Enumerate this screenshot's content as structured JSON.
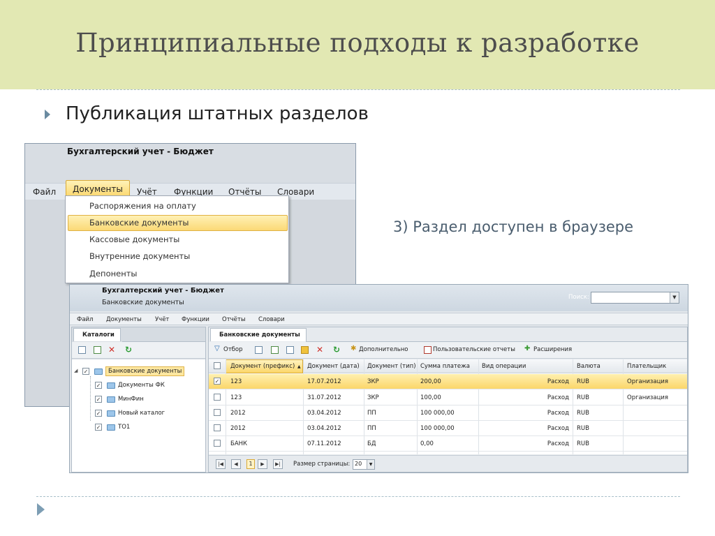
{
  "slide": {
    "title": "Принципиальные подходы к разработке",
    "bullet": "Публикация штатных разделов",
    "note": "3) Раздел доступен в браузере"
  },
  "desktop": {
    "title": "Бухгалтерский учет - Бюджет",
    "menu": [
      "Файл",
      "Документы",
      "Учёт",
      "Функции",
      "Отчёты",
      "Словари"
    ],
    "dropdown": [
      "Распоряжения на оплату",
      "Банковские документы",
      "Кассовые документы",
      "Внутренние документы",
      "Депоненты"
    ]
  },
  "web": {
    "title": "Бухгалтерский учет - Бюджет",
    "subtitle": "Банковские документы",
    "search_label": "Поиск:",
    "search_value": "",
    "menu": [
      "Файл",
      "Документы",
      "Учёт",
      "Функции",
      "Отчёты",
      "Словари"
    ],
    "left_tab": "Каталоги",
    "tree": [
      {
        "label": "Банковские документы",
        "checked": true,
        "selected": true
      },
      {
        "label": "Документы ФК",
        "checked": true
      },
      {
        "label": "МинФин",
        "checked": true
      },
      {
        "label": "Новый каталог",
        "checked": true
      },
      {
        "label": "ТО1",
        "checked": true
      }
    ],
    "right_tab": "Банковские документы",
    "toolbar": {
      "filter": "Отбор",
      "extra": "Дополнительно",
      "user_reports": "Пользовательские отчеты",
      "extensions": "Расширения"
    },
    "grid": {
      "columns": [
        "Документ (префикс)",
        "Документ (дата)",
        "Документ (тип)",
        "Сумма платежа",
        "Вид операции",
        "Валюта",
        "Плательщик"
      ],
      "rows": [
        [
          "123",
          "17.07.2012",
          "ЗКР",
          "200,00",
          "Расход",
          "RUB",
          "Организация"
        ],
        [
          "123",
          "31.07.2012",
          "ЗКР",
          "100,00",
          "Расход",
          "RUB",
          "Организация"
        ],
        [
          "2012",
          "03.04.2012",
          "ПП",
          "100 000,00",
          "Расход",
          "RUB",
          ""
        ],
        [
          "2012",
          "03.04.2012",
          "ПП",
          "100 000,00",
          "Расход",
          "RUB",
          ""
        ],
        [
          "БАНК",
          "07.11.2012",
          "БД",
          "0,00",
          "Расход",
          "RUB",
          ""
        ]
      ]
    },
    "pager": {
      "page": "1",
      "size_label": "Размер страницы:",
      "size_value": "20"
    }
  },
  "colors": {
    "title_band": "#e2e8b3",
    "highlight": "#fbd66a",
    "accent": "#6a8aa0"
  }
}
